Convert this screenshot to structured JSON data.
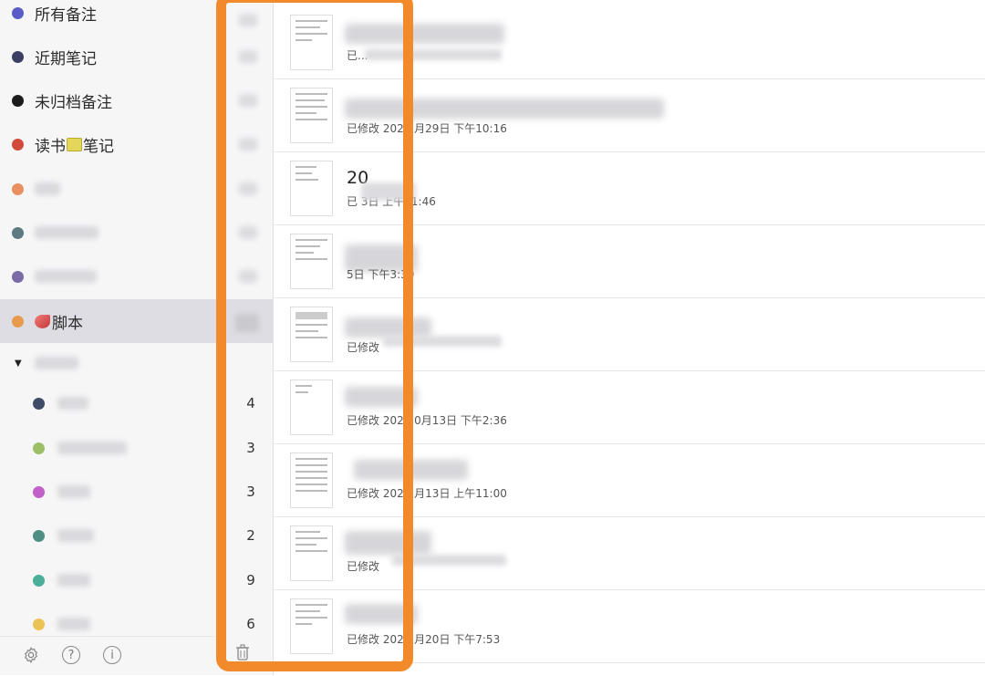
{
  "sidebar": {
    "notebooks": [
      {
        "label": "所有备注",
        "color": "#5b5bc7"
      },
      {
        "label": "近期笔记",
        "color": "#3b3f63"
      },
      {
        "label": "未归档备注",
        "color": "#1c1c1c"
      },
      {
        "label": "读书",
        "label_suffix": "笔记",
        "emoji": "green-book-icon",
        "color": "#d24b3a"
      },
      {
        "label": "",
        "color": "#e89060"
      },
      {
        "label": "",
        "color": "#5d7a80"
      },
      {
        "label": "",
        "color": "#7a6aa6"
      },
      {
        "label": "脚本",
        "emoji": "shell-icon",
        "color": "#e89a4c",
        "selected": true
      }
    ],
    "group_label": "",
    "sub_notebooks": [
      {
        "label": "",
        "color": "#3f4a66"
      },
      {
        "label": "",
        "color": "#9cbf68"
      },
      {
        "label": "",
        "color": "#c060c8"
      },
      {
        "label": "",
        "color": "#4f8f82"
      },
      {
        "label": "",
        "color": "#4aae98"
      },
      {
        "label": "",
        "color": "#ecc455"
      }
    ],
    "footer": {
      "help": "?",
      "info": "i"
    }
  },
  "counts": [
    "4",
    "3",
    "3",
    "2",
    "9",
    "6"
  ],
  "notes": [
    {
      "title": "",
      "meta": "已..."
    },
    {
      "title": "",
      "meta": "已修改 202   1月29日 下午10:16"
    },
    {
      "title": "20",
      "meta": "已              3日 上午11:46"
    },
    {
      "title": "",
      "meta": "              5日 下午3:39"
    },
    {
      "title": "",
      "meta": "已修改"
    },
    {
      "title": "",
      "meta": "已修改 202   10月13日 下午2:36"
    },
    {
      "title": "",
      "meta": "已修改 202   2月13日 上午11:00"
    },
    {
      "title": "",
      "meta": "已修改"
    },
    {
      "title": "",
      "meta": "已修改 202   2月20日 下午7:53"
    }
  ],
  "colors": {
    "highlight": "#f28a2c",
    "selected_bg": "#dedde3",
    "sidebar_bg": "#f6f6f7"
  }
}
